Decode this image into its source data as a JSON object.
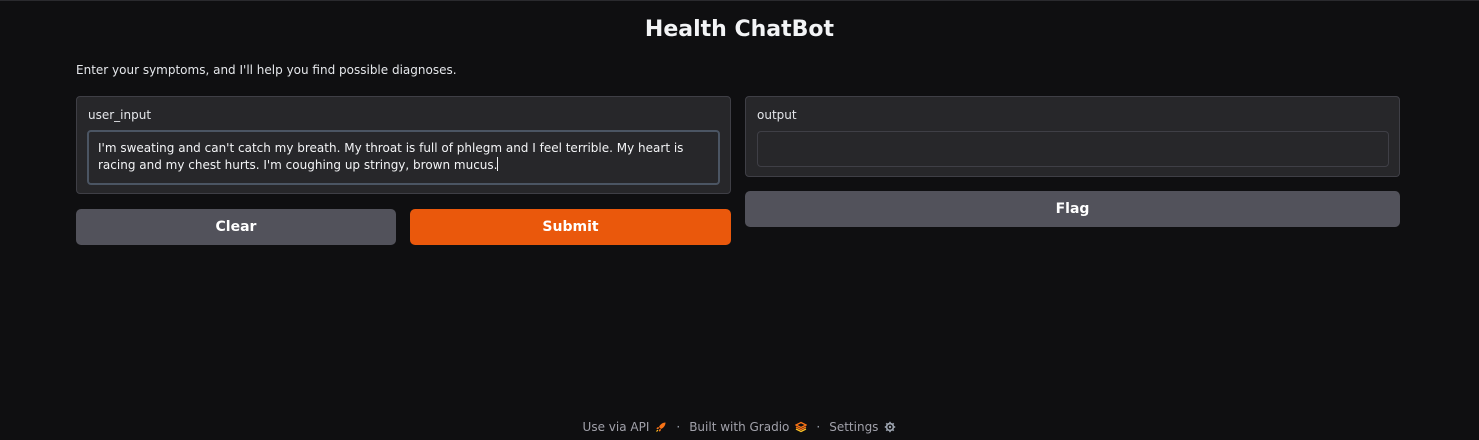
{
  "page": {
    "title": "Health ChatBot",
    "description": "Enter your symptoms, and I'll help you find possible diagnoses."
  },
  "input": {
    "label": "user_input",
    "value": "I'm sweating and can't catch my breath. My throat is full of phlegm and I feel terrible. My heart is racing and my chest hurts. I'm coughing up stringy, brown mucus."
  },
  "output": {
    "label": "output",
    "value": ""
  },
  "buttons": {
    "clear": "Clear",
    "submit": "Submit",
    "flag": "Flag"
  },
  "footer": {
    "api": "Use via API",
    "built": "Built with Gradio",
    "settings": "Settings",
    "separator": "·"
  },
  "colors": {
    "accent": "#ea580c",
    "secondary_button": "#52525b",
    "panel": "#27272a",
    "background": "#0f0f11"
  },
  "icons": {
    "api": "rocket-icon",
    "gradio": "gradio-logo-icon",
    "settings": "gear-icon"
  }
}
